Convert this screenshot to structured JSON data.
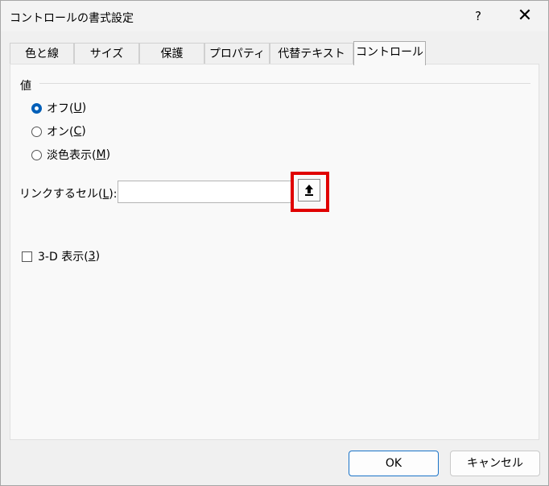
{
  "window": {
    "title": "コントロールの書式設定",
    "help_label": "?",
    "close_label": "✕"
  },
  "tabs": [
    {
      "label": "色と線"
    },
    {
      "label": "サイズ"
    },
    {
      "label": "保護"
    },
    {
      "label": "プロパティ"
    },
    {
      "label": "代替テキスト"
    },
    {
      "label": "コントロール",
      "selected": true
    }
  ],
  "value_group": {
    "label": "値",
    "options": [
      {
        "text": "オフ(",
        "key": "U",
        "suffix": ")",
        "selected": true
      },
      {
        "text": "オン(",
        "key": "C",
        "suffix": ")",
        "selected": false
      },
      {
        "text": "淡色表示(",
        "key": "M",
        "suffix": ")",
        "selected": false
      }
    ]
  },
  "linked_cell": {
    "label_text": "リンクするセル(",
    "label_key": "L",
    "label_suffix": "):",
    "value": ""
  },
  "three_d": {
    "text": "3-D 表示(",
    "key": "3",
    "suffix": ")",
    "checked": false
  },
  "buttons": {
    "ok": "OK",
    "cancel": "キャンセル"
  },
  "colors": {
    "accent": "#005fb8",
    "highlight": "#e00000"
  }
}
